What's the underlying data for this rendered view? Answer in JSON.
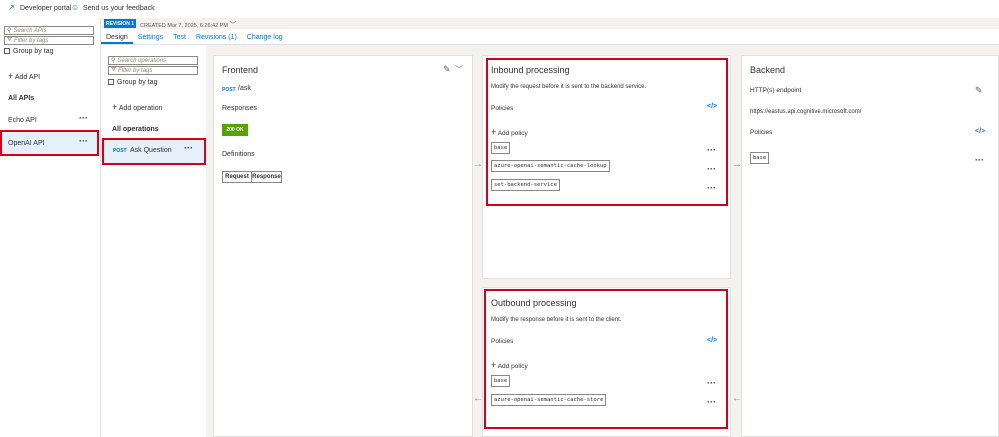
{
  "topbar": {
    "developer_portal": "Developer portal",
    "feedback": "Send us your feedback"
  },
  "left": {
    "search_placeholder": "Search APIs",
    "filter_placeholder": "Filter by tags",
    "group_by_tag": "Group by tag",
    "add_api": "Add API",
    "section": "All APIs",
    "apis": [
      {
        "name": "Echo API"
      },
      {
        "name": "OpenAI API"
      }
    ]
  },
  "revision": {
    "badge": "REVISION 1",
    "created": "CREATED Mar 7, 2025, 6:26:42 PM"
  },
  "tabs": [
    "Design",
    "Settings",
    "Test",
    "Revisions (1)",
    "Change log"
  ],
  "ops": {
    "search_placeholder": "Search operations",
    "filter_placeholder": "Filter by tags",
    "group_by_tag": "Group by tag",
    "add_operation": "Add operation",
    "section": "All operations",
    "item_method": "POST",
    "item_name": "Ask Question"
  },
  "frontend": {
    "title": "Frontend",
    "method": "POST",
    "path": "/ask",
    "responses_label": "Responses",
    "status": "200 OK",
    "definitions_label": "Definitions",
    "request_btn": "Request",
    "response_btn": "Response"
  },
  "inbound": {
    "title": "Inbound processing",
    "desc": "Modify the request before it is sent to the backend service.",
    "policies_label": "Policies",
    "add_policy": "Add policy",
    "policies": [
      "base",
      "azure-openai-semantic-cache-lookup",
      "set-backend-service"
    ]
  },
  "outbound": {
    "title": "Outbound processing",
    "desc": "Modify the response before it is sent to the client.",
    "policies_label": "Policies",
    "add_policy": "Add policy",
    "policies": [
      "base",
      "azure-openai-semantic-cache-store"
    ]
  },
  "backend": {
    "title": "Backend",
    "endpoint_label": "HTTP(s) endpoint",
    "endpoint_url": "https://eastus.api.cognitive.microsoft.com/",
    "policies_label": "Policies",
    "policy": "base"
  },
  "colors": {
    "accent": "#0078d4",
    "highlight_red": "#d0021b",
    "success_green": "#57a300"
  }
}
